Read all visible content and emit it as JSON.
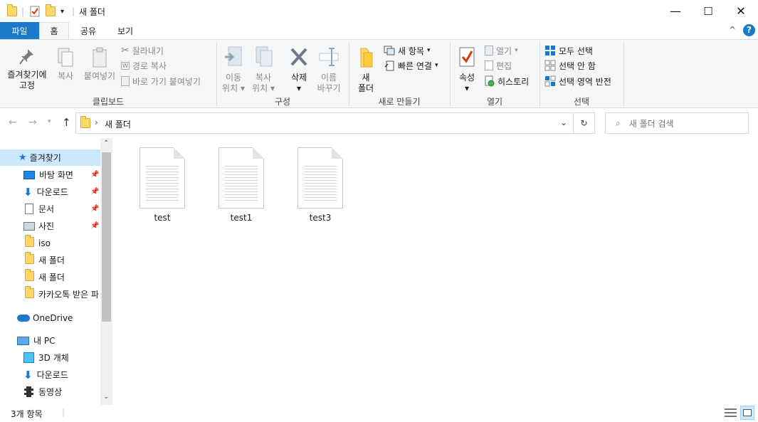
{
  "window": {
    "title": "새 폴더",
    "controls": {
      "minimize": "—",
      "maximize": "☐",
      "close": "✕"
    }
  },
  "ribbon_tabs": [
    {
      "label": "파일",
      "active": false
    },
    {
      "label": "홈",
      "active": true
    },
    {
      "label": "공유",
      "active": false
    },
    {
      "label": "보기",
      "active": false
    }
  ],
  "ribbon": {
    "clipboard": {
      "group": "클립보드",
      "pin_line1": "즐겨찾기에",
      "pin_line2": "고정",
      "copy": "복사",
      "paste": "붙여넣기",
      "cut": "잘라내기",
      "copy_path": "경로 복사",
      "paste_shortcut": "바로 가기 붙여넣기"
    },
    "organize": {
      "group": "구성",
      "move_line1": "이동",
      "move_line2": "위치",
      "copyto_line1": "복사",
      "copyto_line2": "위치",
      "delete": "삭제",
      "rename_line1": "이름",
      "rename_line2": "바꾸기"
    },
    "new": {
      "group": "새로 만들기",
      "folder_line1": "새",
      "folder_line2": "폴더",
      "new_item": "새 항목",
      "easy_access": "빠른 연결"
    },
    "open": {
      "group": "열기",
      "properties": "속성",
      "open": "열기",
      "edit": "편집",
      "history": "히스토리"
    },
    "select": {
      "group": "선택",
      "select_all": "모두 선택",
      "select_none": "선택 안 함",
      "invert": "선택 영역 반전"
    }
  },
  "address": {
    "breadcrumb": "새 폴더",
    "search_placeholder": "새 폴더 검색"
  },
  "nav_pane": {
    "quick_access": "즐겨찾기",
    "items": [
      {
        "label": "바탕 화면",
        "pinned": true
      },
      {
        "label": "다운로드",
        "pinned": true
      },
      {
        "label": "문서",
        "pinned": true
      },
      {
        "label": "사진",
        "pinned": true
      },
      {
        "label": "iso",
        "pinned": false
      },
      {
        "label": "새 폴더",
        "pinned": false
      },
      {
        "label": "새 폴더",
        "pinned": false
      },
      {
        "label": "카카오톡 받은 파",
        "pinned": false
      }
    ],
    "onedrive": "OneDrive",
    "this_pc": "내 PC",
    "pc_items": [
      "3D 개체",
      "다운로드",
      "동영상"
    ]
  },
  "files": [
    {
      "name": "test"
    },
    {
      "name": "test1"
    },
    {
      "name": "test3"
    }
  ],
  "status": {
    "count": "3개 항목"
  },
  "colors": {
    "accent": "#1979ca",
    "selection": "#cce8ff",
    "folder": "#ffd866"
  }
}
